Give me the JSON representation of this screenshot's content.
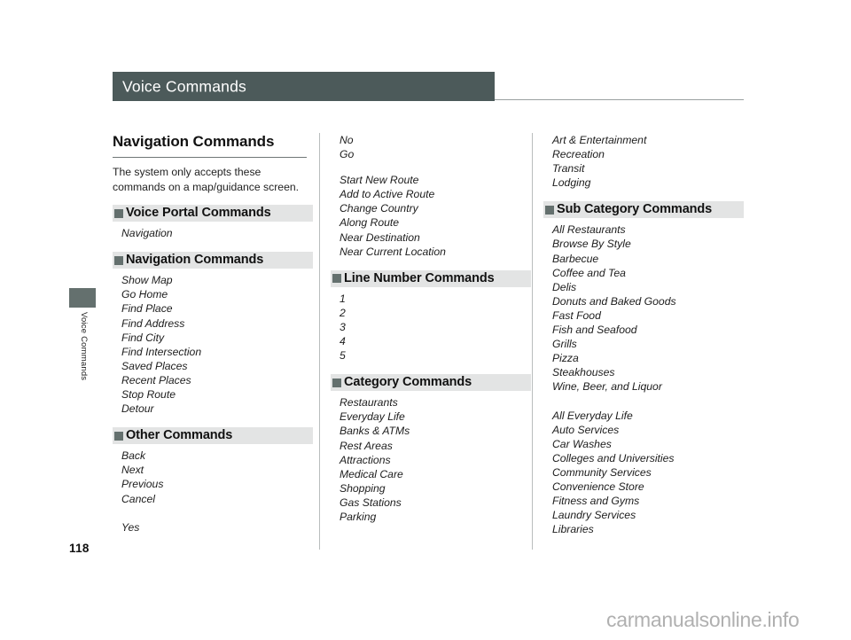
{
  "document": {
    "title": "Voice Commands",
    "page_number": "118",
    "side_tab_label": "Voice Commands",
    "watermark": "carmanualsonline.info"
  },
  "colors": {
    "title_bar": "#4c5a5a",
    "bar_heading_bg": "#e3e4e4",
    "bullet": "#64706e",
    "rule": "#9aa0a0"
  },
  "columns": {
    "left": {
      "section_title": "Navigation Commands",
      "intro": "The system only accepts these commands on a map/guidance screen.",
      "blocks": [
        {
          "heading": "Voice Portal Commands",
          "items": [
            "Navigation"
          ]
        },
        {
          "heading": "Navigation Commands",
          "items": [
            "Show Map",
            "Go Home",
            "Find Place",
            "Find Address",
            "Find City",
            "Find Intersection",
            "Saved Places",
            "Recent Places",
            "Stop Route",
            "Detour"
          ]
        },
        {
          "heading": "Other Commands",
          "items": [
            "Back",
            "Next",
            "Previous",
            "Cancel",
            "",
            "Yes"
          ]
        }
      ]
    },
    "middle": {
      "continued_items": [
        "No",
        "Go"
      ],
      "continued_items_2": [
        "Start New Route",
        "Add to Active Route",
        "Change Country",
        "Along Route",
        "Near Destination",
        "Near Current Location"
      ],
      "blocks": [
        {
          "heading": "Line Number Commands",
          "items": [
            "1",
            "2",
            "3",
            "4",
            "5"
          ]
        },
        {
          "heading": "Category Commands",
          "items": [
            "Restaurants",
            "Everyday Life",
            "Banks & ATMs",
            "Rest Areas",
            "Attractions",
            "Medical Care",
            "Shopping",
            "Gas Stations",
            "Parking"
          ]
        }
      ]
    },
    "right": {
      "continued_items": [
        "Art & Entertainment",
        "Recreation",
        "Transit",
        "Lodging"
      ],
      "blocks": [
        {
          "heading": "Sub Category Commands",
          "items": [
            "All Restaurants",
            "Browse By Style",
            "Barbecue",
            "Coffee and Tea",
            "Delis",
            "Donuts and Baked Goods",
            "Fast Food",
            "Fish and Seafood",
            "Grills",
            "Pizza",
            "Steakhouses",
            "Wine, Beer, and Liquor",
            "",
            "All Everyday Life",
            "Auto Services",
            "Car Washes",
            "Colleges and Universities",
            "Community Services",
            "Convenience Store",
            "Fitness and Gyms",
            "Laundry Services",
            "Libraries"
          ]
        }
      ]
    }
  }
}
